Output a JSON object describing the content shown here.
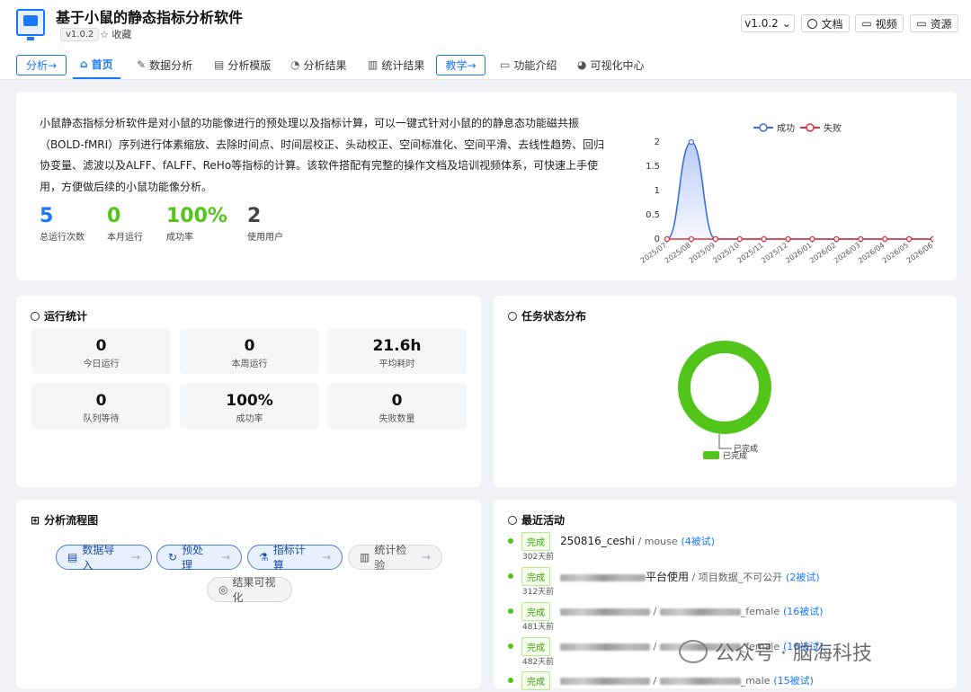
{
  "app": {
    "title": "基于小鼠的静态指标分析软件",
    "version_badge": "v1.0.2",
    "favorite": "☆ 收藏"
  },
  "header": {
    "version_select": "v1.0.2",
    "docs": "文档",
    "video": "视频",
    "resources": "资源"
  },
  "nav": {
    "analysis_pill": "分析→",
    "home": "首页",
    "data_analysis": "数据分析",
    "analysis_template": "分析模版",
    "analysis_result": "分析结果",
    "stat_result": "统计结果",
    "teaching_pill": "教学→",
    "features": "功能介绍",
    "viz_center": "可视化中心"
  },
  "intro": {
    "text": "小鼠静态指标分析软件是对小鼠的功能像进行的预处理以及指标计算，可以一键式针对小鼠的的静息态功能磁共振（BOLD-fMRI）序列进行体素缩放、去除时间点、时间层校正、头动校正、空间标准化、空间平滑、去线性趋势、回归协变量、滤波以及ALFF、fALFF、ReHo等指标的计算。该软件搭配有完整的操作文档及培训视频体系，可快速上手使用，方便做后续的小鼠功能像分析。",
    "stats": [
      {
        "value": "5",
        "label": "总运行次数",
        "color": "#1677ff"
      },
      {
        "value": "0",
        "label": "本月运行",
        "color": "#52c41a"
      },
      {
        "value": "100%",
        "label": "成功率",
        "color": "#52c41a"
      },
      {
        "value": "2",
        "label": "使用用户",
        "color": "#444444"
      }
    ]
  },
  "chart_data": {
    "type": "line",
    "categories": [
      "2025/07",
      "2025/08",
      "2025/09",
      "2025/10",
      "2025/11",
      "2025/12",
      "2026/01",
      "2026/02",
      "2026/03",
      "2026/04",
      "2026/05",
      "2026/06"
    ],
    "series": [
      {
        "name": "成功",
        "values": [
          0,
          2,
          0,
          0,
          0,
          0,
          0,
          0,
          0,
          0,
          0,
          0
        ],
        "color": "#3b6fe0"
      },
      {
        "name": "失败",
        "values": [
          0,
          0,
          0,
          0,
          0,
          0,
          0,
          0,
          0,
          0,
          0,
          0
        ],
        "color": "#e0343c"
      }
    ],
    "ylim": [
      0,
      2
    ],
    "yticks": [
      "0",
      "0.5",
      "1",
      "1.5",
      "2"
    ],
    "legend": "top"
  },
  "run_stats": {
    "title": "运行统计",
    "cells": [
      {
        "value": "0",
        "label": "今日运行"
      },
      {
        "value": "0",
        "label": "本周运行"
      },
      {
        "value": "21.6h",
        "label": "平均耗时"
      },
      {
        "value": "0",
        "label": "队列等待"
      },
      {
        "value": "100%",
        "label": "成功率"
      },
      {
        "value": "0",
        "label": "失败数量"
      }
    ]
  },
  "task_status": {
    "title": "任务状态分布",
    "slices": [
      {
        "name": "已完成",
        "value": 100,
        "color": "#52c41a"
      }
    ],
    "label": "已完成",
    "legend": "已完成"
  },
  "flow": {
    "title": "分析流程图",
    "steps": [
      "数据导入",
      "预处理",
      "指标计算",
      "统计检验",
      "结果可视化"
    ]
  },
  "activity": {
    "title": "最近活动",
    "items": [
      {
        "badge": "完成",
        "name": "250816_ceshi",
        "sep": " / ",
        "sub": "mouse",
        "count": "(4被试)",
        "time": "302天前"
      },
      {
        "badge": "完成",
        "name": "平台使用",
        "sep": " / ",
        "sub": "项目数据_不可公开",
        "count": "(2被试)",
        "time": "312天前"
      },
      {
        "badge": "完成",
        "name": "",
        "sep": " / ",
        "sub": "female",
        "count": "(16被试)",
        "time": "481天前"
      },
      {
        "badge": "完成",
        "name": "",
        "sep": " / ",
        "sub": "female",
        "count": "(16被试)",
        "time": "482天前"
      },
      {
        "badge": "完成",
        "name": "",
        "sep": " / ",
        "sub": "male",
        "count": "(15被试)",
        "time": ""
      }
    ]
  },
  "watermark": {
    "text": "公众号 · 脑海科技"
  }
}
